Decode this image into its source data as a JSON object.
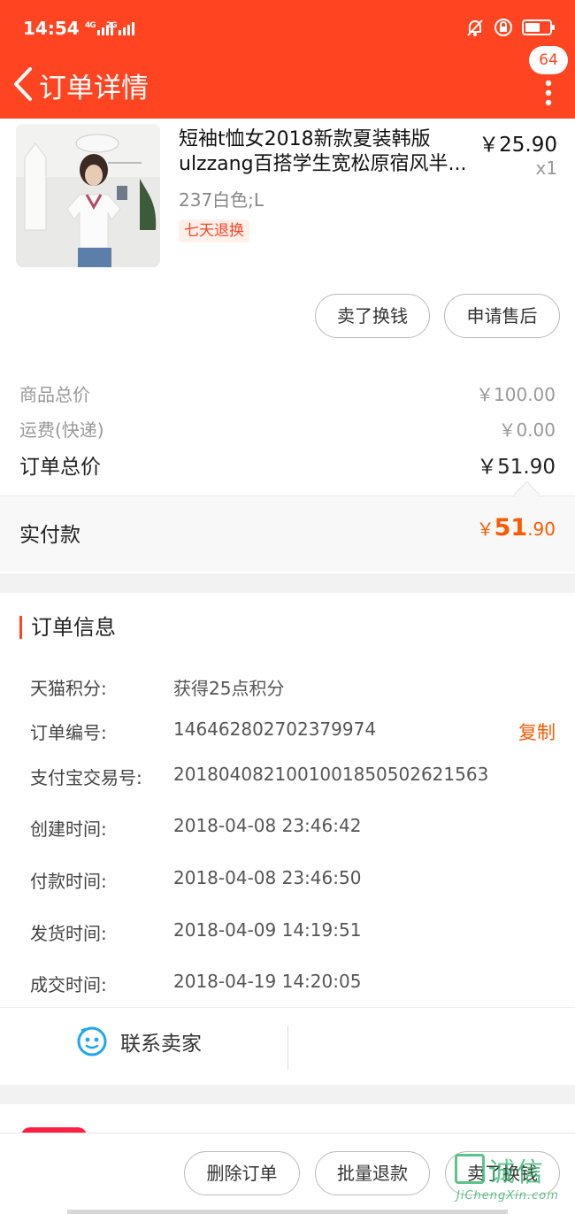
{
  "status_bar": {
    "time": "14:54",
    "signal_1": "4G",
    "signal_2": "2G",
    "battery_level": 0.6
  },
  "nav": {
    "title": "订单详情",
    "message_count": "64"
  },
  "product": {
    "title": "短袖t恤女2018新款夏装韩版ulzzang百搭学生宽松原宿风半...",
    "price": "￥25.90",
    "quantity": "x1",
    "sku": "237白色;L",
    "tag": "七天退换",
    "btn_sell": "卖了换钱",
    "btn_aftersale": "申请售后"
  },
  "prices": {
    "goods_total_label": "商品总价",
    "goods_total_value": "￥100.00",
    "shipping_label": "运费(快递)",
    "shipping_value": "￥0.00",
    "order_total_label": "订单总价",
    "order_total_value": "￥51.90",
    "paid_label": "实付款",
    "paid_symbol": "￥",
    "paid_int": "51",
    "paid_dec": ".90"
  },
  "order_info": {
    "title": "订单信息",
    "rows": [
      {
        "label": "天猫积分:",
        "value": "获得25点积分"
      },
      {
        "label": "订单编号:",
        "value": "146462802702379974"
      },
      {
        "label": "支付宝交易号:",
        "value": "2018040821001001850502621563"
      },
      {
        "label": "创建时间:",
        "value": "2018-04-08 23:46:42"
      },
      {
        "label": "付款时间:",
        "value": "2018-04-08 23:46:50"
      },
      {
        "label": "发货时间:",
        "value": "2018-04-09 14:19:51"
      },
      {
        "label": "成交时间:",
        "value": "2018-04-19 14:20:05"
      }
    ],
    "copy_label": "复制",
    "contact_seller": "联系卖家"
  },
  "bottom_bar": {
    "delete_order": "删除订单",
    "batch_refund": "批量退款",
    "sell": "卖了换钱"
  },
  "watermark": {
    "text": "诚信",
    "sub": "JiChengXin.com"
  },
  "colors": {
    "brand": "#ff4422",
    "accent_orange": "#ff5a00",
    "watermark_green": "#2eb46b"
  }
}
